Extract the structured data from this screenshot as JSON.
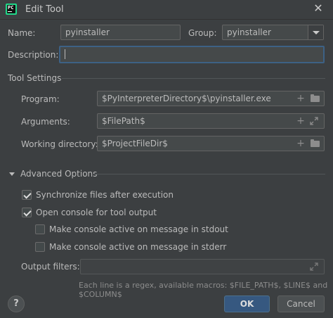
{
  "window": {
    "title": "Edit Tool",
    "app_icon": "pycharm-icon",
    "close_icon": "✕"
  },
  "form": {
    "name_label": "Name:",
    "name_value": "pyinstaller",
    "group_label": "Group:",
    "group_value": "pyinstaller",
    "description_label": "Description:",
    "description_value": ""
  },
  "tool_settings": {
    "title": "Tool Settings",
    "program_label": "Program:",
    "program_value": "$PyInterpreterDirectory$\\pyinstaller.exe",
    "arguments_label": "Arguments:",
    "arguments_value": "$FilePath$",
    "working_dir_label": "Working directory:",
    "working_dir_value": "$ProjectFileDir$",
    "plus_icon": "+"
  },
  "advanced": {
    "title": "Advanced Options",
    "sync_label": "Synchronize files after execution",
    "sync_checked": true,
    "console_label": "Open console for tool output",
    "console_checked": true,
    "stdout_label": "Make console active on message in stdout",
    "stdout_checked": false,
    "stderr_label": "Make console active on message in stderr",
    "stderr_checked": false,
    "output_filters_label": "Output filters:",
    "output_filters_value": "",
    "hint": "Each line is a regex, available macros: $FILE_PATH$, $LINE$ and $COLUMN$"
  },
  "footer": {
    "help_label": "?",
    "ok_label": "OK",
    "cancel_label": "Cancel"
  },
  "colors": {
    "background": "#3c3f41",
    "field": "#45494a",
    "focus": "#3d6185",
    "ok": "#365880"
  }
}
